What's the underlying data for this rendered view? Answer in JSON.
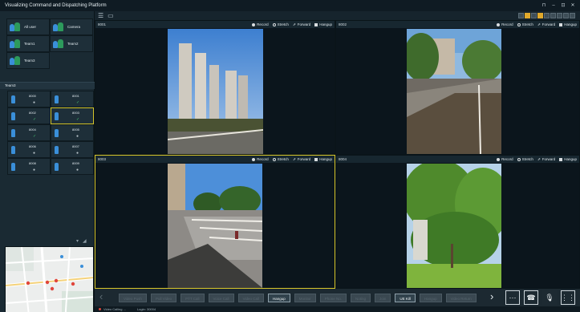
{
  "window": {
    "title": "Visualizing Command and Dispatching Platform",
    "controls": [
      "⊓",
      "–",
      "⊡",
      "✕"
    ]
  },
  "groups": [
    {
      "label": "All user"
    },
    {
      "label": "Camera"
    },
    {
      "label": "Team1"
    },
    {
      "label": "Team2"
    },
    {
      "label": "Team3"
    }
  ],
  "members_header": "Team3",
  "members": [
    {
      "label": "8000",
      "status": "●",
      "online": false
    },
    {
      "label": "8001",
      "status": "✓",
      "online": true
    },
    {
      "label": "8002",
      "status": "✓",
      "online": true
    },
    {
      "label": "8003",
      "status": "✓",
      "online": true,
      "selected": true
    },
    {
      "label": "8004",
      "status": "✓",
      "online": true
    },
    {
      "label": "8005",
      "status": "●",
      "online": false
    },
    {
      "label": "8006",
      "status": "●",
      "online": false
    },
    {
      "label": "8007",
      "status": "●",
      "online": false
    },
    {
      "label": "8008",
      "status": "●",
      "online": false
    },
    {
      "label": "8009",
      "status": "●",
      "online": false
    }
  ],
  "videos": [
    {
      "id": "8001",
      "record": "Record",
      "stretch": "Stretch",
      "forward": "Forward",
      "hangup": "Hangup"
    },
    {
      "id": "8002",
      "record": "Record",
      "stretch": "Stretch",
      "forward": "Forward",
      "hangup": "Hangup"
    },
    {
      "id": "8003",
      "record": "Record",
      "stretch": "Stretch",
      "forward": "Forward",
      "hangup": "Hangup"
    },
    {
      "id": "8004",
      "record": "Record",
      "stretch": "Stretch",
      "forward": "Forward",
      "hangup": "Hangup"
    }
  ],
  "bottom_buttons": [
    {
      "label": "Video Push",
      "enabled": false
    },
    {
      "label": "Pull Video",
      "enabled": false
    },
    {
      "label": "PTT Call",
      "enabled": false
    },
    {
      "label": "Voice Call",
      "enabled": false
    },
    {
      "label": "Video Call",
      "enabled": false
    },
    {
      "label": "Hangup",
      "enabled": true
    },
    {
      "label": "Monitor",
      "enabled": false
    },
    {
      "label": "Phone No.",
      "enabled": false
    },
    {
      "label": "Noting",
      "enabled": false
    },
    {
      "label": "Join",
      "enabled": false
    },
    {
      "label": "UE Kill",
      "enabled": true
    },
    {
      "label": "Hangup",
      "enabled": false
    },
    {
      "label": "Video Return",
      "enabled": false
    }
  ],
  "status": {
    "state": "Video Calling ...",
    "user": "Login: 30004"
  },
  "colors": {
    "accent_selected": "#d8c62a",
    "toolbar_active": "#e0a92c",
    "online": "#46c071"
  }
}
